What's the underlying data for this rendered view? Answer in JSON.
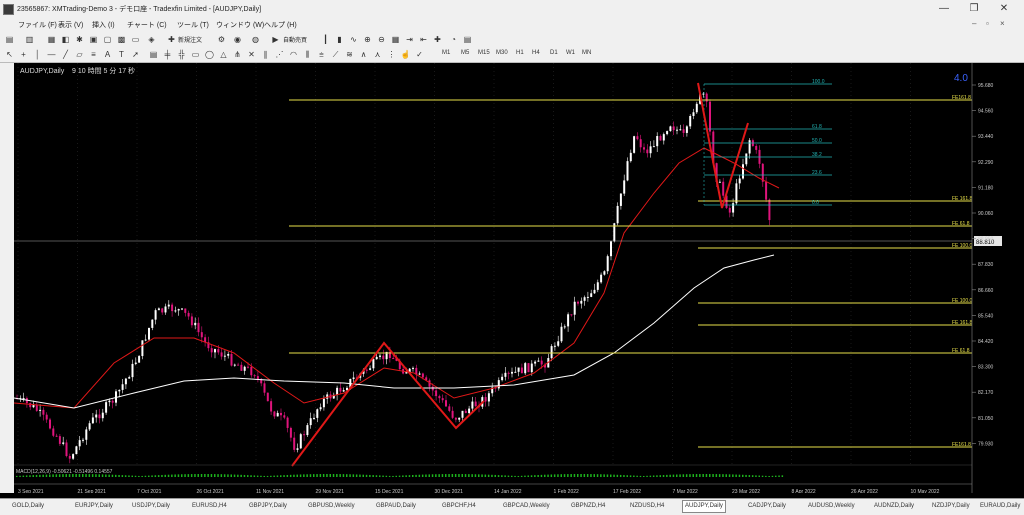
{
  "window": {
    "title": "23565867: XMTrading-Demo 3 - デモ口座 - Tradexfin Limited - [AUDJPY,Daily]",
    "minimize": "—",
    "restore": "❐",
    "close": "✕"
  },
  "menu": {
    "items": [
      "ファイル (F)",
      "表示 (V)",
      "挿入 (I)",
      "チャート (C)",
      "ツール (T)",
      "ウィンドウ (W)",
      "ヘルプ (H)"
    ],
    "right_icons": [
      "minimize-child",
      "restore-child",
      "close-child"
    ]
  },
  "toolbar": {
    "new_order": "新規注文",
    "auto_trade": "自動売買",
    "timeframes": [
      "M1",
      "M5",
      "M15",
      "M30",
      "H1",
      "H4",
      "D1",
      "W1",
      "MN"
    ]
  },
  "chart": {
    "symbol_label": "AUDJPY,Daily",
    "countdown": "9 10 時間 5 分 17 秒",
    "corner_label": "4.0",
    "cursor_price": "88.810",
    "indicator_label": "MACD(12,26,9) -0.50621 -0.51496 0.14557",
    "price_labels": [
      "95.680",
      "94.560",
      "93.440",
      "92.290",
      "91.180",
      "90.060",
      "88.950",
      "87.830",
      "86.660",
      "85.540",
      "84.420",
      "83.300",
      "82.170",
      "81.050",
      "79.930"
    ],
    "date_labels": [
      "3 Sep 2021",
      "21 Sep 2021",
      "7 Oct 2021",
      "26 Oct 2021",
      "11 Nov 2021",
      "29 Nov 2021",
      "15 Dec 2021",
      "30 Dec 2021",
      "14 Jan 2022",
      "1 Feb 2022",
      "17 Feb 2022",
      "7 Mar 2022",
      "23 Mar 2022",
      "8 Apr 2022",
      "26 Apr 2022",
      "10 May 2022"
    ],
    "fib_levels": [
      "100.0",
      "61.8",
      "50.0",
      "38.2",
      "23.6",
      "0.0"
    ],
    "yellow_labels": [
      "FE161.8",
      "FE 61.8",
      "FE 161.8",
      "FE 100.0",
      "FE 100.0",
      "FE 161.8",
      "FE 61.8",
      "FE161.8"
    ]
  },
  "tabs": [
    "GOLD,Daily",
    "EURJPY,Daily",
    "USDJPY,Daily",
    "EURUSD,H4",
    "GBPJPY,Daily",
    "GBPUSD,Weekly",
    "GBPAUD,Daily",
    "GBPCHF,H4",
    "GBPCAD,Weekly",
    "GBPNZD,H4",
    "NZDUSD,H4",
    "AUDJPY,Daily",
    "CADJPY,Daily",
    "AUDUSD,Weekly",
    "AUDNZD,Daily",
    "NZDJPY,Daily",
    "EURAUD,Daily"
  ],
  "active_tab_index": 11
}
